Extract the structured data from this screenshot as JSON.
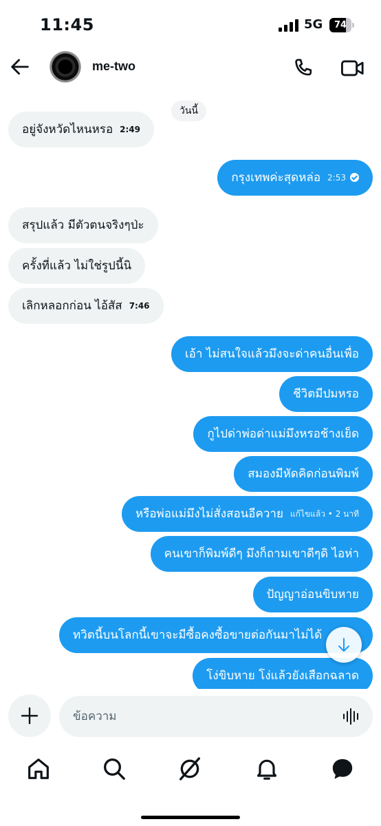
{
  "status_bar": {
    "time": "11:45",
    "network": "5G",
    "battery": "74",
    "battery_level": 0.74
  },
  "header": {
    "contact_name": "me-two"
  },
  "chat": {
    "date_label": "วันนี้",
    "messages": [
      {
        "direction": "in",
        "text": "อยู่จังหวัดไหนหรอ",
        "time": "2:49"
      },
      {
        "direction": "out",
        "text": "กรุงเทพค่ะสุดหล่อ",
        "time": "2:53",
        "read": true
      },
      {
        "direction": "in",
        "text": "สรุปแล้ว มีตัวตนจริงๆป่ะ"
      },
      {
        "direction": "in",
        "text": "ครั้งที่แล้ว ไม่ใช่รูปนี้นิ"
      },
      {
        "direction": "in",
        "text": "เลิกหลอกก่อน ไอ้สัส",
        "time": "7:46"
      },
      {
        "direction": "out",
        "text": "เอ้า ไม่สนใจแล้วมึงจะด่าคนอื่นเพื่อ"
      },
      {
        "direction": "out",
        "text": "ชีวิตมีปมหรอ"
      },
      {
        "direction": "out",
        "text": "กูไปด่าพ่อด่าแม่มึงหรอช้างเย็ด"
      },
      {
        "direction": "out",
        "text": "สมองมีหัดคิดก่อนพิมพ์"
      },
      {
        "direction": "out",
        "text": "หรือพ่อแม่มึงไม่สั่งสอนอีควาย",
        "time": "แก้ไขแล้ว • 2 นาที"
      },
      {
        "direction": "out",
        "text": "คนเขาก็พิมพ์ดีๆ มึงก็ถามเขาดีๆดิ ไอห่า"
      },
      {
        "direction": "out",
        "text": "ปัญญาอ่อนขิบหาย"
      },
      {
        "direction": "out",
        "text": "ทวิตนี้บนโลกนี้เขาจะมีซื้อคงซื้อขายต่อกันมาไม่ได้"
      },
      {
        "direction": "out",
        "text": "โง่ขิบหาย โง่แล้วยังเสือกฉลาด"
      }
    ]
  },
  "composer": {
    "placeholder": "ข้อความ"
  },
  "icons": {
    "back": "arrow-left-icon",
    "call": "phone-icon",
    "video": "video-camera-icon",
    "add": "plus-icon",
    "mic": "waveform-icon",
    "scroll": "arrow-down-icon",
    "home": "home-icon",
    "search": "search-icon",
    "grok": "grok-icon",
    "notifications": "bell-icon",
    "messages": "messages-icon"
  },
  "colors": {
    "accent": "#1d9bf0",
    "incoming_bubble": "#eff3f4",
    "text": "#0f1419"
  }
}
